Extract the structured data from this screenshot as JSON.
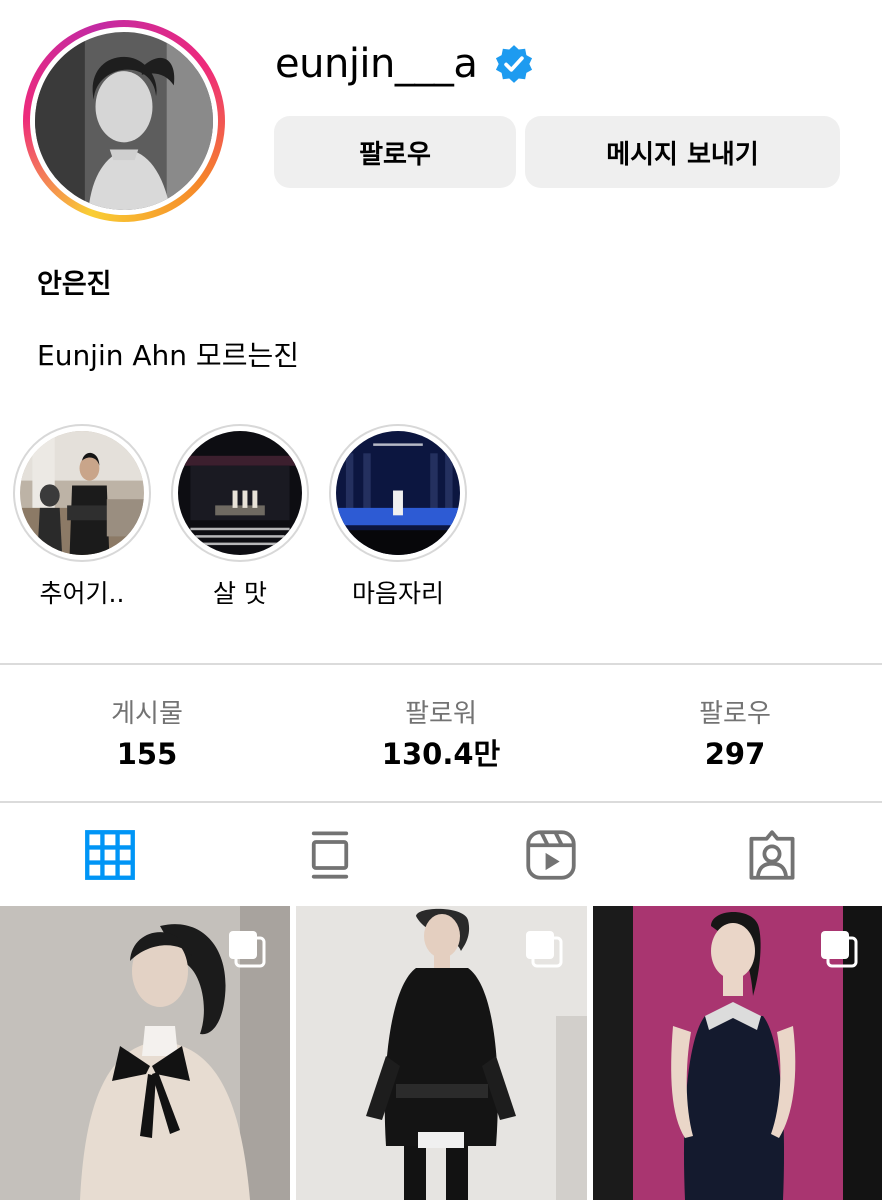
{
  "profile": {
    "username": "eunjin___a",
    "verified": true,
    "display_name": "안은진",
    "bio": "Eunjin Ahn 모르는진",
    "story_ring_colors": [
      "#f9ce34",
      "#ee2a7b",
      "#c32aa3",
      "#f58529"
    ],
    "verified_color": "#1d9bf0"
  },
  "actions": {
    "follow_label": "팔로우",
    "message_label": "메시지 보내기"
  },
  "highlights": [
    {
      "label": "추어기.."
    },
    {
      "label": "살 맛"
    },
    {
      "label": "마음자리"
    }
  ],
  "stats": {
    "posts": {
      "label": "게시물",
      "value": "155"
    },
    "followers": {
      "label": "팔로워",
      "value": "130.4만"
    },
    "following": {
      "label": "팔로우",
      "value": "297"
    }
  },
  "tabs": [
    {
      "name": "grid-icon",
      "active": true
    },
    {
      "name": "feed-icon",
      "active": false
    },
    {
      "name": "reels-icon",
      "active": false
    },
    {
      "name": "tagged-icon",
      "active": false
    }
  ],
  "colors": {
    "active_tab": "#0095f6",
    "inactive_tab": "#737373",
    "button_bg": "#efefef"
  },
  "posts": [
    {
      "multiple": true
    },
    {
      "multiple": true
    },
    {
      "multiple": true
    }
  ]
}
